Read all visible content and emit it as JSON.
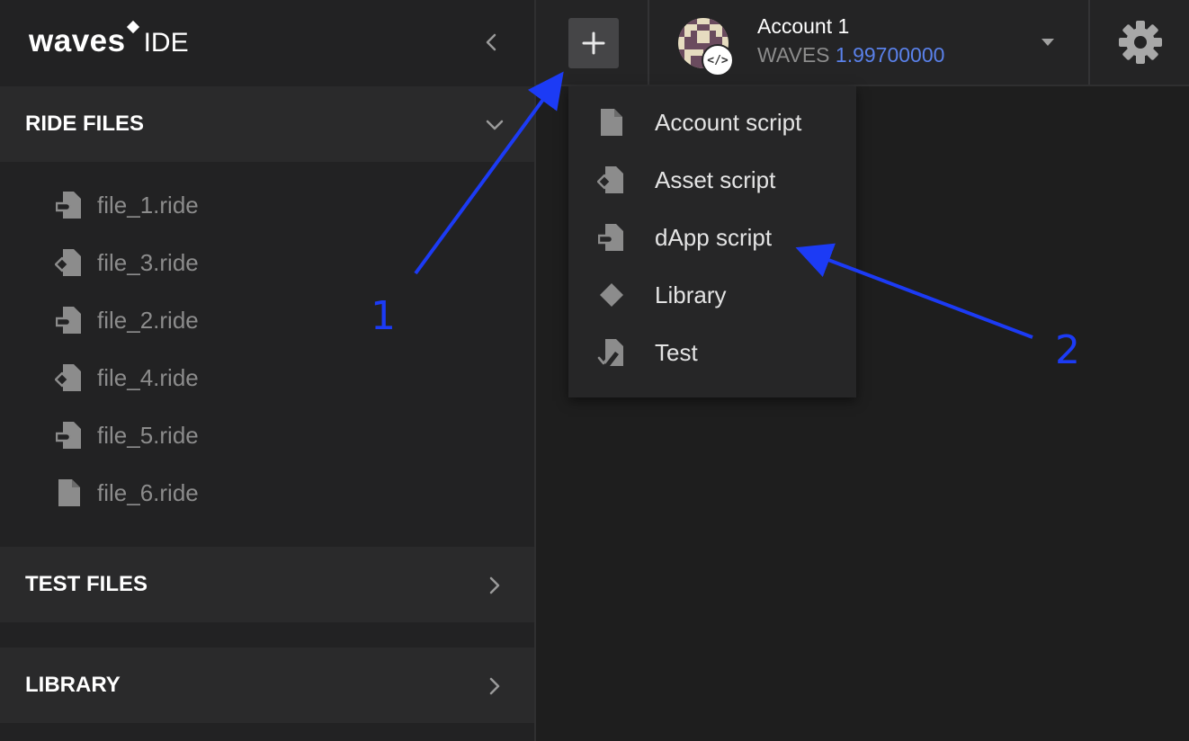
{
  "sidebar": {
    "logo": {
      "brand": "waves",
      "product": "IDE"
    },
    "sections": [
      {
        "title": "RIDE FILES",
        "expanded": true,
        "files": [
          {
            "name": "file_1.ride",
            "icon": "dapp-script-icon"
          },
          {
            "name": "file_3.ride",
            "icon": "asset-script-icon"
          },
          {
            "name": "file_2.ride",
            "icon": "dapp-script-icon"
          },
          {
            "name": "file_4.ride",
            "icon": "asset-script-icon"
          },
          {
            "name": "file_5.ride",
            "icon": "dapp-script-icon"
          },
          {
            "name": "file_6.ride",
            "icon": "account-script-icon"
          }
        ]
      },
      {
        "title": "TEST FILES",
        "expanded": false
      },
      {
        "title": "LIBRARY",
        "expanded": false
      }
    ]
  },
  "topbar": {
    "add_button_icon": "plus-icon",
    "account": {
      "name": "Account 1",
      "currency": "WAVES",
      "balance": "1.99700000",
      "badge": "</>"
    },
    "settings_icon": "gear-icon"
  },
  "new_file_menu": {
    "items": [
      {
        "label": "Account script",
        "icon": "account-script-icon"
      },
      {
        "label": "Asset script",
        "icon": "asset-script-icon"
      },
      {
        "label": "dApp script",
        "icon": "dapp-script-icon"
      },
      {
        "label": "Library",
        "icon": "library-diamond-icon"
      },
      {
        "label": "Test",
        "icon": "test-script-icon"
      }
    ]
  },
  "annotations": [
    {
      "number": "1"
    },
    {
      "number": "2"
    }
  ],
  "colors": {
    "sidebar_bg": "#222223",
    "section_header_bg": "#2a2a2b",
    "editor_bg": "#1e1e1e",
    "balance_accent": "#5a81ea",
    "annotation_blue": "#1c3bf5"
  }
}
